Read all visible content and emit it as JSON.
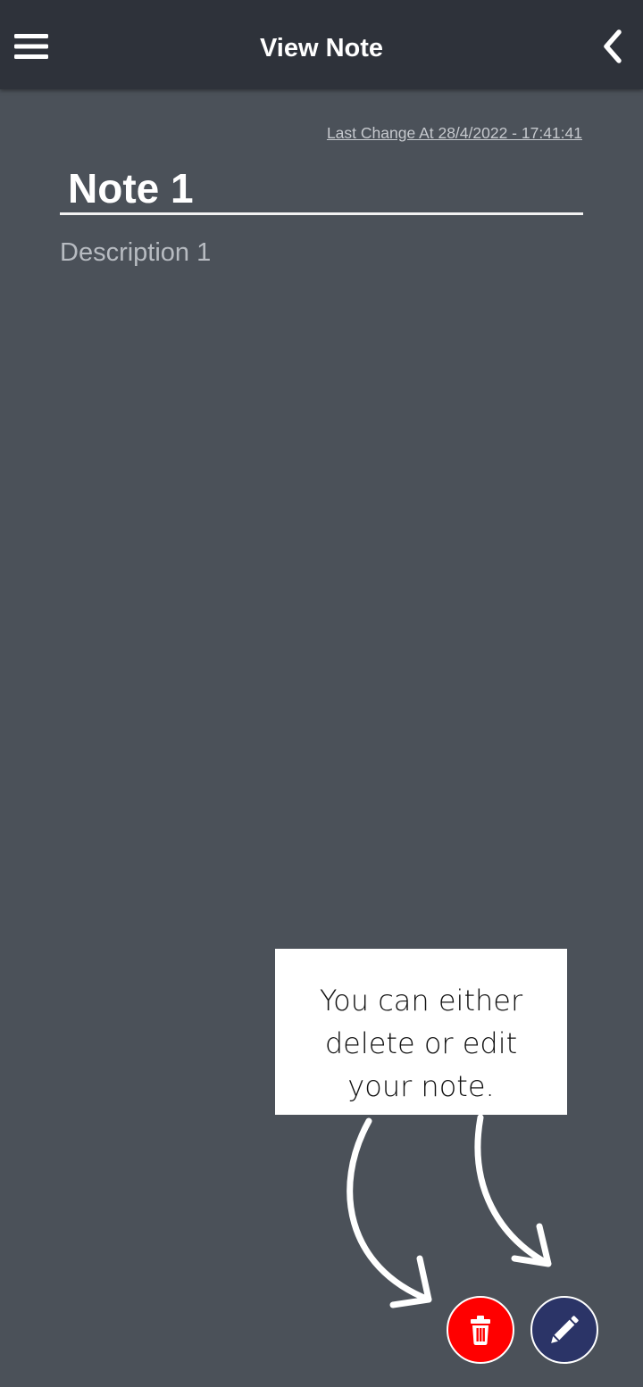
{
  "app_bar": {
    "title": "View Note",
    "menu_icon": "hamburger-menu-icon",
    "back_icon": "chevron-left-icon",
    "background": "#2e323a"
  },
  "note": {
    "last_change": "Last Change At 28/4/2022 - 17:41:41",
    "title": "Note 1",
    "description": "Description 1"
  },
  "tip": {
    "text": "You can either delete or edit your note."
  },
  "actions": {
    "delete_icon": "trash-icon",
    "delete_color": "#ff0000",
    "edit_icon": "pencil-icon",
    "edit_color": "#2b3467"
  },
  "colors": {
    "background": "#4b5159"
  }
}
